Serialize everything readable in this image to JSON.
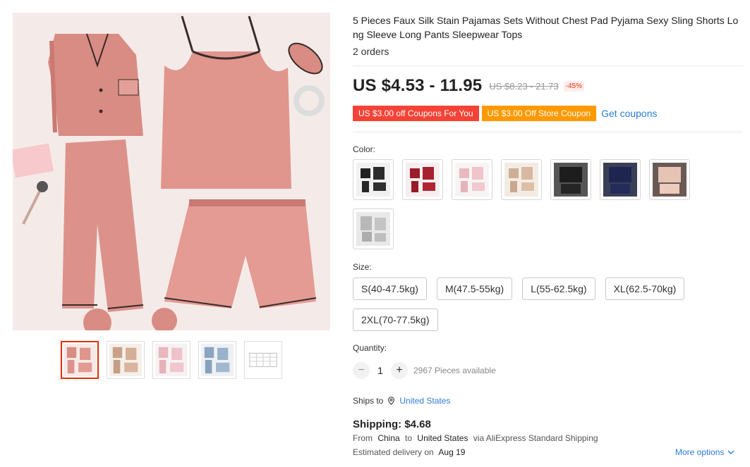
{
  "product": {
    "title": "5 Pieces Faux Silk Stain Pajamas Sets Without Chest Pad Pyjama Sexy Sling Shorts Long Sleeve Long Pants Sleepwear Tops",
    "orders": "2 orders"
  },
  "gallery": {
    "main_image": "pink-satin-pajama-set",
    "thumbnails": [
      "pink-set",
      "champagne-set",
      "light-pink-set",
      "blue-set",
      "size-chart"
    ]
  },
  "price": {
    "current": "US $4.53 - 11.95",
    "original": "US $8.23 - 21.73",
    "discount": "-45%"
  },
  "coupons": {
    "items": [
      "US $3.00 off Coupons For You",
      "US $3.00 Off Store Coupon"
    ],
    "link": "Get coupons"
  },
  "color": {
    "label": "Color:",
    "options": [
      "black",
      "wine-red",
      "light-pink",
      "champagne",
      "black-lace",
      "navy-lace",
      "nude-lace",
      "silver-gray"
    ]
  },
  "size": {
    "label": "Size:",
    "options": [
      "S(40-47.5kg)",
      "M(47.5-55kg)",
      "L(55-62.5kg)",
      "XL(62.5-70kg)",
      "2XL(70-77.5kg)"
    ]
  },
  "quantity": {
    "label": "Quantity:",
    "value": "1",
    "available": "2967 Pieces available"
  },
  "shipping": {
    "ships_to_label": "Ships to",
    "ships_to_country": "United States",
    "cost": "Shipping: $4.68",
    "from_prefix": "From",
    "from": "China",
    "to_prefix": "to",
    "to": "United States",
    "via": "via AliExpress Standard Shipping",
    "delivery_prefix": "Estimated delivery on",
    "delivery_date": "Aug 19",
    "more_options": "More options"
  },
  "colors": {
    "price_red": "#e62e04",
    "coupon_red": "#f44336",
    "coupon_orange": "#fe9900",
    "link_blue": "#2e7cd6"
  }
}
